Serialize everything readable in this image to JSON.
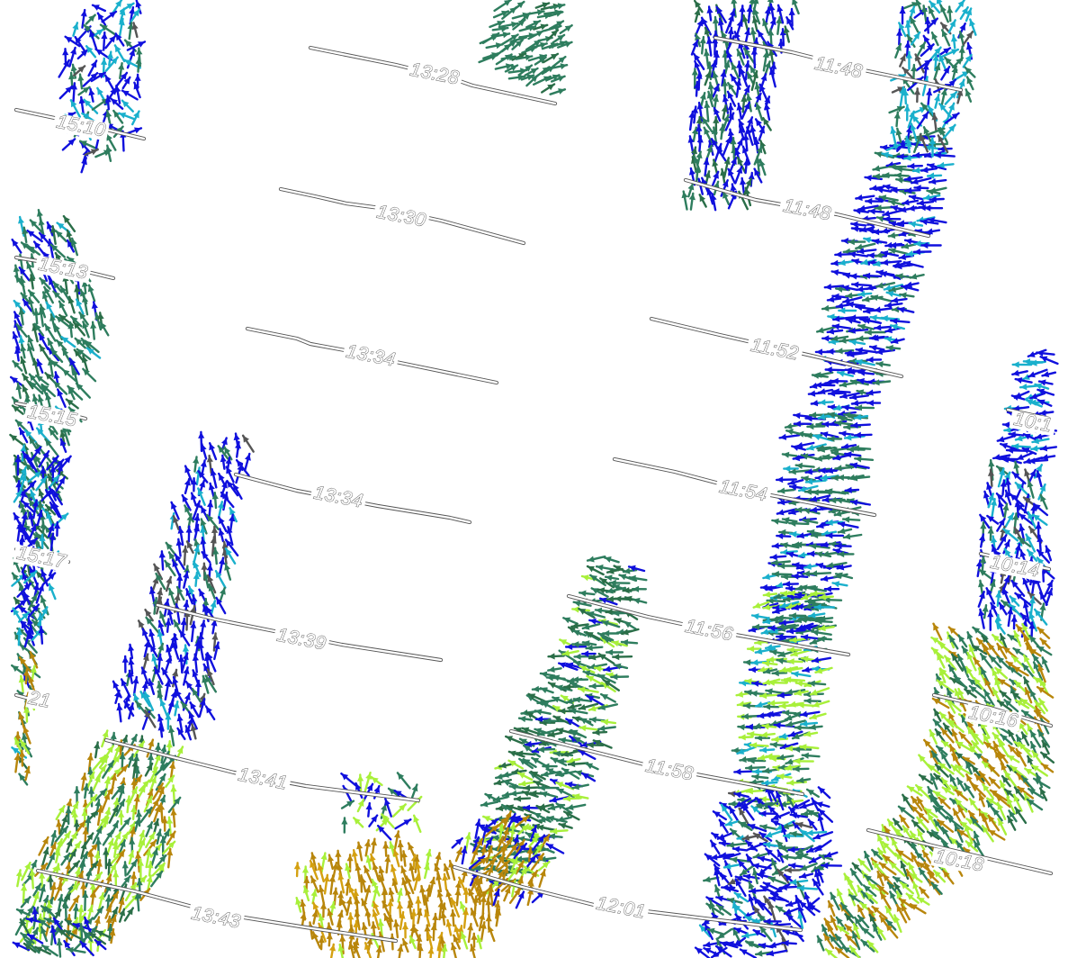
{
  "view": {
    "background": "#ffffff"
  },
  "palette": {
    "blue": "#1010dd",
    "cyan": "#1ab0cc",
    "teal_green": "#2e7d5e",
    "dark_green": "#2a6e48",
    "lime": "#a8f03a",
    "yellow_green": "#c8e03a",
    "ochre": "#b8860b",
    "gold": "#d4a010",
    "gray": "#555555",
    "dark_gray": "#444444"
  },
  "time_labels": [
    {
      "id": "t-1328",
      "text": "13:28"
    },
    {
      "id": "t-1330",
      "text": "13:30"
    },
    {
      "id": "t-1334a",
      "text": "13:34"
    },
    {
      "id": "t-1334b",
      "text": "13:34"
    },
    {
      "id": "t-1339",
      "text": "13:39"
    },
    {
      "id": "t-1341",
      "text": "13:41"
    },
    {
      "id": "t-1343",
      "text": "13:43"
    },
    {
      "id": "t-1148a",
      "text": "11:48"
    },
    {
      "id": "t-1148b",
      "text": "11:48"
    },
    {
      "id": "t-1152",
      "text": "11:52"
    },
    {
      "id": "t-1154",
      "text": "11:54"
    },
    {
      "id": "t-1156",
      "text": "11:56"
    },
    {
      "id": "t-1158",
      "text": "11:58"
    },
    {
      "id": "t-1201",
      "text": "12:01"
    },
    {
      "id": "t-1510",
      "text": "15:10"
    },
    {
      "id": "t-1513",
      "text": "15:13"
    },
    {
      "id": "t-1515",
      "text": "15:15"
    },
    {
      "id": "t-1517",
      "text": "15:17"
    },
    {
      "id": "t-1521",
      "text": "21"
    },
    {
      "id": "t-1610",
      "text": "10:1"
    },
    {
      "id": "t-1614",
      "text": "10:14"
    },
    {
      "id": "t-1616",
      "text": "10:16"
    },
    {
      "id": "t-1618",
      "text": "10:18"
    }
  ]
}
